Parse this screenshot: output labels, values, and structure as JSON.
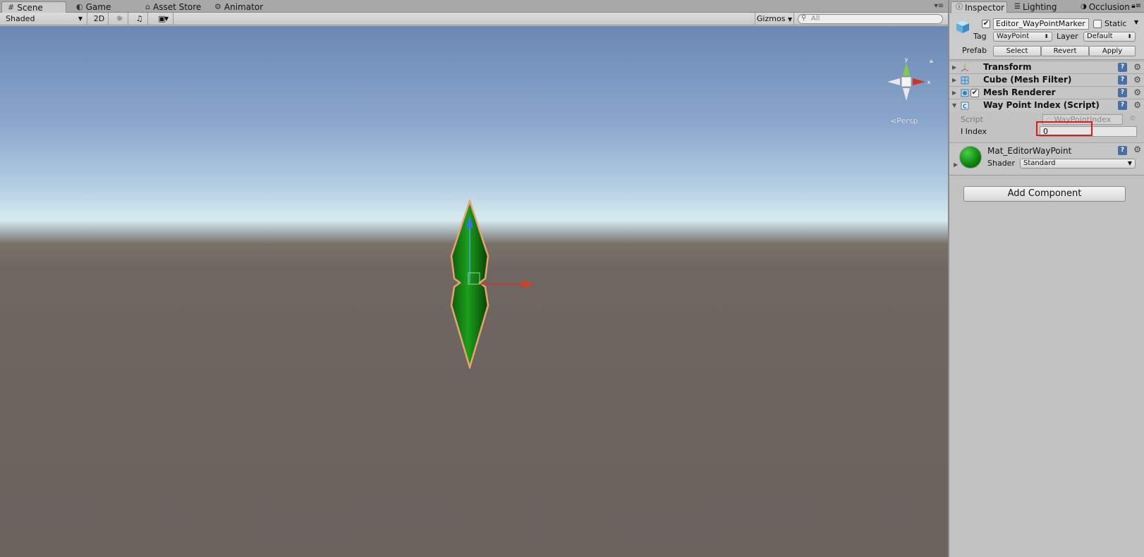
{
  "scene_tabs": {
    "scene": "Scene",
    "game": "Game",
    "asset_store": "Asset Store",
    "animator": "Animator"
  },
  "scene_toolbar": {
    "shading": "Shaded",
    "mode_2d": "2D",
    "gizmos": "Gizmos",
    "search_placeholder": "All"
  },
  "viewport": {
    "projection_label": "Persp",
    "axis_y": "y",
    "axis_x": "x"
  },
  "inspector_tabs": {
    "inspector": "Inspector",
    "lighting": "Lighting",
    "occlusion": "Occlusion"
  },
  "object": {
    "name": "Editor_WayPointMarker",
    "active": true,
    "static_label": "Static",
    "tag_label": "Tag",
    "tag_value": "WayPoint",
    "layer_label": "Layer",
    "layer_value": "Default",
    "prefab_label": "Prefab",
    "prefab_select": "Select",
    "prefab_revert": "Revert",
    "prefab_apply": "Apply"
  },
  "components": [
    {
      "title": "Transform",
      "icon": "transform-icon"
    },
    {
      "title": "Cube (Mesh Filter)",
      "icon": "mesh-filter-icon"
    },
    {
      "title": "Mesh Renderer",
      "icon": "mesh-renderer-icon",
      "enabled": true
    },
    {
      "title": "Way Point Index (Script)",
      "icon": "script-icon",
      "expanded": true
    }
  ],
  "script_component": {
    "script_label": "Script",
    "script_value": "WayPointIndex",
    "index_label": "I Index",
    "index_value": "0"
  },
  "material": {
    "name": "Mat_EditorWayPoint",
    "shader_label": "Shader",
    "shader_value": "Standard"
  },
  "add_component": "Add Component",
  "colors": {
    "highlight": "#e01818",
    "marker_green": "#0f8a0f",
    "selection_outline": "#f0a070"
  }
}
